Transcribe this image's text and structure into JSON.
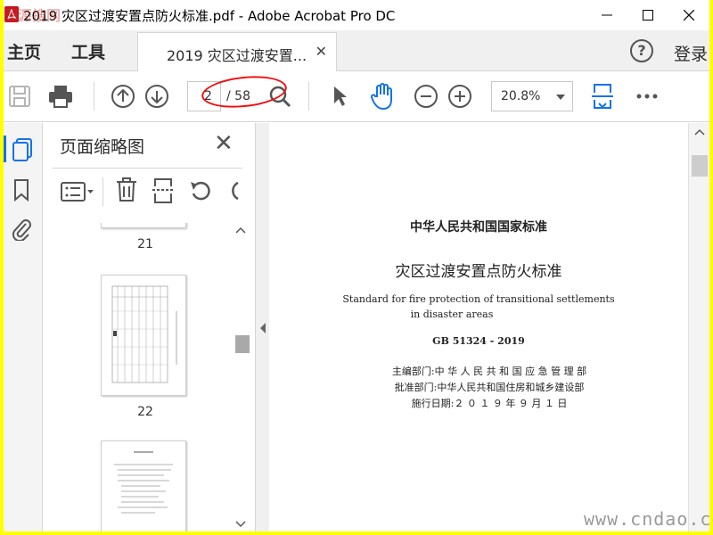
{
  "window": {
    "title": "2019 灾区过渡安置点防火标准.pdf - Adobe Acrobat Pro DC"
  },
  "menu": {
    "home": "主页",
    "tools": "工具",
    "doc_tab": "2019 灾区过渡安置...",
    "login": "登录"
  },
  "toolbar": {
    "page_current": "2",
    "page_total": "/ 58",
    "zoom": "20.8%",
    "annotation_color": "#e11111"
  },
  "panel": {
    "title": "页面缩略图",
    "thumbnails": [
      {
        "page": "21"
      },
      {
        "page": "22"
      }
    ]
  },
  "document": {
    "line1": "中华人民共和国国家标准",
    "line2": "灾区过渡安置点防火标准",
    "line3": "Standard for fire protection of transitional settlements",
    "line4": "in disaster areas",
    "code": "GB 51324 - 2019",
    "dept1": "主编部门:中 华 人 民 共 和 国 应 急 管 理 部",
    "dept2": "批准部门:中华人民共和国住房和城乡建设部",
    "date": "施行日期:２ ０ １ ９ 年 ９ 月 １ 日"
  },
  "watermark": {
    "logo": "图源搜网",
    "site": "www.cndao.com"
  },
  "colors": {
    "accent": "#1473e6",
    "frame": "#ffff00"
  }
}
